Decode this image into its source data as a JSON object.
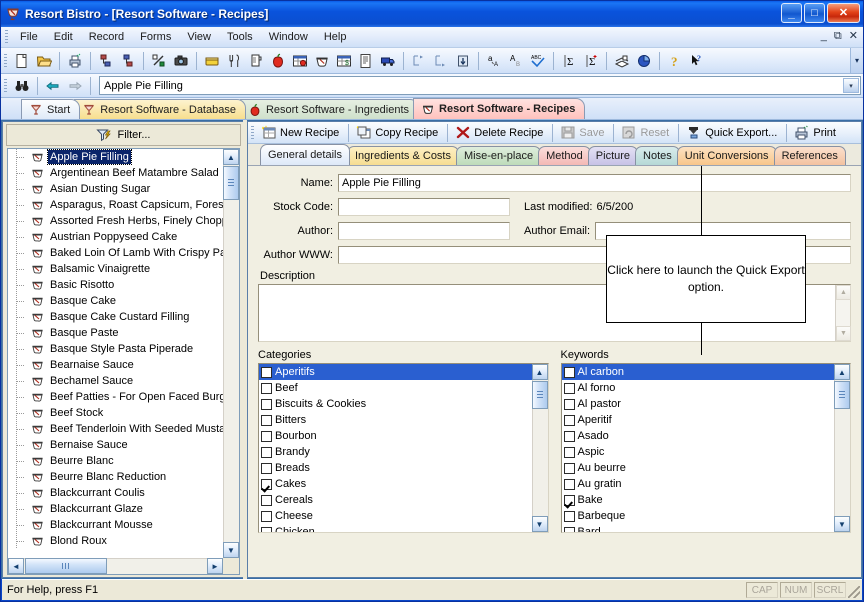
{
  "window": {
    "app_name": "Resort Bistro",
    "document_title": "[Resort Software - Recipes]",
    "title_full": "Resort Bistro - [Resort Software - Recipes]",
    "buttons": {
      "minimize": "_",
      "maximize": "□",
      "close": "✕"
    },
    "mdi_buttons": {
      "minimize": "_",
      "restore": "⧉",
      "close": "✕"
    }
  },
  "menubar": {
    "items": [
      "File",
      "Edit",
      "Record",
      "Forms",
      "View",
      "Tools",
      "Window",
      "Help"
    ]
  },
  "toolbar_main": {
    "icons": [
      "new-document-icon",
      "open-folder-icon",
      "print-icon",
      "organize-down-icon",
      "organize-up-icon",
      "percent-icon",
      "camera-icon",
      "menu-card-icon",
      "cutlery-icon",
      "measuring-jug-icon",
      "apple-icon",
      "ingredient-grid-icon",
      "mixing-bowl-icon",
      "costing-grid-icon",
      "report-icon",
      "delivery-truck-icon",
      "indent-in-icon",
      "indent-out-icon",
      "move-down-icon",
      "sort-az-icon",
      "sort-az-alt-icon",
      "spellcheck-icon",
      "sum-icon",
      "sum-plus-icon",
      "pages-icon",
      "pie-chart-icon",
      "help-icon",
      "context-help-icon"
    ],
    "overflow_label": "▾"
  },
  "toolbar_nav": {
    "find_icon": "binoculars-icon",
    "back_icon": "arrow-left-icon",
    "forward_icon": "arrow-right-icon",
    "combo_value": "Apple Pie Filling",
    "combo_arrow": "▾"
  },
  "document_tabs": [
    {
      "label": "Start",
      "icon": "cocktail-glass-icon",
      "active": false
    },
    {
      "label": "Resort Software - Database",
      "icon": "cocktail-glass-icon",
      "active": false
    },
    {
      "label": "Resort Software - Ingredients",
      "icon": "apple-icon",
      "active": false
    },
    {
      "label": "Resort Software - Recipes",
      "icon": "mixing-bowl-icon",
      "active": true
    }
  ],
  "left_pane": {
    "filter_button": "Filter...",
    "filter_icon": "funnel-icon",
    "tree_items": [
      {
        "label": "Apple Pie Filling",
        "selected": true
      },
      {
        "label": "Argentinean Beef Matambre Salad",
        "selected": false
      },
      {
        "label": "Asian Dusting Sugar",
        "selected": false
      },
      {
        "label": "Asparagus, Roast Capsicum, Forest I",
        "selected": false
      },
      {
        "label": "Assorted Fresh Herbs, Finely Choppe",
        "selected": false
      },
      {
        "label": "Austrian Poppyseed Cake",
        "selected": false
      },
      {
        "label": "Baked Loin Of Lamb With Crispy Par",
        "selected": false
      },
      {
        "label": "Balsamic Vinaigrette",
        "selected": false
      },
      {
        "label": "Basic Risotto",
        "selected": false
      },
      {
        "label": "Basque Cake",
        "selected": false
      },
      {
        "label": "Basque Cake Custard Filling",
        "selected": false
      },
      {
        "label": "Basque Paste",
        "selected": false
      },
      {
        "label": "Basque Style Pasta Piperade",
        "selected": false
      },
      {
        "label": "Bearnaise Sauce",
        "selected": false
      },
      {
        "label": "Bechamel Sauce",
        "selected": false
      },
      {
        "label": "Beef Patties - For Open Faced Burge",
        "selected": false
      },
      {
        "label": "Beef Stock",
        "selected": false
      },
      {
        "label": "Beef Tenderloin With Seeded Musta",
        "selected": false
      },
      {
        "label": "Bernaise Sauce",
        "selected": false
      },
      {
        "label": "Beurre Blanc",
        "selected": false
      },
      {
        "label": "Beurre Blanc Reduction",
        "selected": false
      },
      {
        "label": "Blackcurrant Coulis",
        "selected": false
      },
      {
        "label": "Blackcurrant Glaze",
        "selected": false
      },
      {
        "label": "Blackcurrant Mousse",
        "selected": false
      },
      {
        "label": "Blond Roux",
        "selected": false
      }
    ]
  },
  "record_toolbar": [
    {
      "label": "New Recipe",
      "icon": "new-recipe-icon",
      "disabled": false
    },
    {
      "label": "Copy Recipe",
      "icon": "copy-recipe-icon",
      "disabled": false
    },
    {
      "label": "Delete Recipe",
      "icon": "delete-x-icon",
      "disabled": false
    },
    {
      "label": "Save",
      "icon": "save-disk-icon",
      "disabled": true
    },
    {
      "label": "Reset",
      "icon": "reset-icon",
      "disabled": true
    },
    {
      "label": "Quick Export...",
      "icon": "quick-export-icon",
      "disabled": false
    },
    {
      "label": "Print",
      "icon": "print-icon",
      "disabled": false
    }
  ],
  "form_tabs": [
    {
      "label": "General details",
      "color": "active",
      "active": true
    },
    {
      "label": "Ingredients & Costs",
      "color": "c-yellow",
      "active": false
    },
    {
      "label": "Mise-en-place",
      "color": "c-green",
      "active": false
    },
    {
      "label": "Method",
      "color": "c-red",
      "active": false
    },
    {
      "label": "Picture",
      "color": "c-purple",
      "active": false
    },
    {
      "label": "Notes",
      "color": "c-teal",
      "active": false
    },
    {
      "label": "Unit Conversions",
      "color": "c-orange",
      "active": false
    },
    {
      "label": "References",
      "color": "c-orange2",
      "active": false
    }
  ],
  "form": {
    "name_label": "Name:",
    "name_value": "Apple Pie Filling",
    "stock_code_label": "Stock Code:",
    "stock_code_value": "",
    "last_modified_label": "Last modified:",
    "last_modified_value": "6/5/200",
    "author_label": "Author:",
    "author_value": "",
    "author_email_label": "Author Email:",
    "author_email_value": "",
    "author_www_label": "Author WWW:",
    "author_www_value": "",
    "description_label": "Description",
    "description_value": ""
  },
  "categories": {
    "caption": "Categories",
    "items": [
      {
        "label": "Aperitifs",
        "checked": false,
        "selected": true
      },
      {
        "label": "Beef",
        "checked": false,
        "selected": false
      },
      {
        "label": "Biscuits & Cookies",
        "checked": false,
        "selected": false
      },
      {
        "label": "Bitters",
        "checked": false,
        "selected": false
      },
      {
        "label": "Bourbon",
        "checked": false,
        "selected": false
      },
      {
        "label": "Brandy",
        "checked": false,
        "selected": false
      },
      {
        "label": "Breads",
        "checked": false,
        "selected": false
      },
      {
        "label": "Cakes",
        "checked": true,
        "selected": false
      },
      {
        "label": "Cereals",
        "checked": false,
        "selected": false
      },
      {
        "label": "Cheese",
        "checked": false,
        "selected": false
      },
      {
        "label": "Chicken",
        "checked": false,
        "selected": false
      }
    ]
  },
  "keywords": {
    "caption": "Keywords",
    "items": [
      {
        "label": "Al carbon",
        "checked": false,
        "selected": true
      },
      {
        "label": "Al forno",
        "checked": false,
        "selected": false
      },
      {
        "label": "Al pastor",
        "checked": false,
        "selected": false
      },
      {
        "label": "Aperitif",
        "checked": false,
        "selected": false
      },
      {
        "label": "Asado",
        "checked": false,
        "selected": false
      },
      {
        "label": "Aspic",
        "checked": false,
        "selected": false
      },
      {
        "label": "Au beurre",
        "checked": false,
        "selected": false
      },
      {
        "label": "Au gratin",
        "checked": false,
        "selected": false
      },
      {
        "label": "Bake",
        "checked": true,
        "selected": false
      },
      {
        "label": "Barbeque",
        "checked": false,
        "selected": false
      },
      {
        "label": "Bard",
        "checked": false,
        "selected": false
      }
    ]
  },
  "callout": {
    "text": "Click here to launch the Quick Export option."
  },
  "statusbar": {
    "hint": "For Help, press F1",
    "panes": [
      "CAP",
      "NUM",
      "SCRL"
    ]
  },
  "colors": {
    "title_blue": "#0a53dc",
    "selection_blue": "#2a5fd0",
    "tree_selection": "#0a246a",
    "face": "#ece9d8",
    "form_face": "#f1efe2",
    "close_red": "#c7280b"
  }
}
